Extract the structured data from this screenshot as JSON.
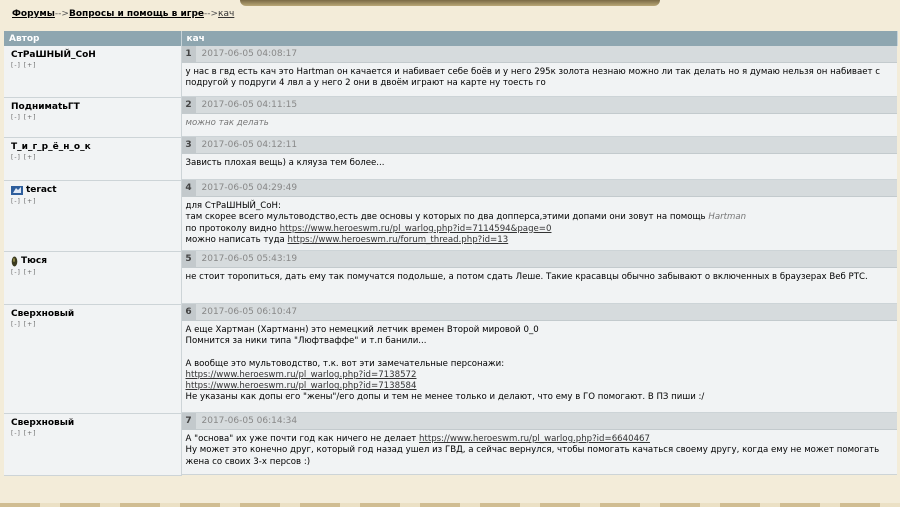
{
  "breadcrumb": {
    "forums": "Форумы",
    "sep1": "-->",
    "section": "Вопросы и помощь в игре",
    "sep2": "-->",
    "topic": "кач"
  },
  "table": {
    "col_author": "Автор",
    "col_topic": "кач"
  },
  "controls_text": "[-] [+]",
  "colors": {
    "header_bg": "#8ea6b0",
    "post_header_bg": "#d6dbdd",
    "post_bg": "#f1f3f4"
  },
  "posts": [
    {
      "author": "СтРаШНЫЙ_СоН",
      "num": "1",
      "date": "2017-06-05 04:08:17",
      "text": "у нас в гвд есть кач это Hartman он качается и набивает себе боёв и у него 295к золота незнаю можно ли так делать но я думаю нельзя он набивает с подругой у подруги 4 лвл а у него 2 они в двоём играют на карте ну тоесть го"
    },
    {
      "author": "ПоднимаtьГТ",
      "num": "2",
      "date": "2017-06-05 04:11:15",
      "text": "можно так делать"
    },
    {
      "author": "Т_и_г_р_ё_н_о_к",
      "num": "3",
      "date": "2017-06-05 04:12:11",
      "text": "Зависть плохая вещь) а кляуза тем более..."
    },
    {
      "author": "teract",
      "icon": "cat-emblem-icon",
      "num": "4",
      "date": "2017-06-05 04:29:49",
      "line1": "для СтРаШНЫЙ_СоН:",
      "line2a": "там скорее всего мультоводство,есть две основы у которых по два допперса,этими допами они зовут на помощь ",
      "line2b": "Hartman",
      "line3a": "по протоколу видно ",
      "link1": "https://www.heroeswm.ru/pl_warlog.php?id=7114594&page=0",
      "line4a": "можно написать туда ",
      "link2": "https://www.heroeswm.ru/forum_thread.php?id=13"
    },
    {
      "author": "Тюся",
      "icon": "bean-emblem-icon",
      "num": "5",
      "date": "2017-06-05 05:43:19",
      "text": "не стоит торопиться, дать ему так помучатся подольше, а потом сдать Леше. Такие красавцы обычно забывают о включенных в браузерах Веб РТС."
    },
    {
      "author": "Сверхновый",
      "num": "6",
      "date": "2017-06-05 06:10:47",
      "line1": "А еще Хартман (Хартманн) это немецкий летчик времен Второй мировой 0_0",
      "line2": "Помнится за ники типа \"Люфтваффе\" и т.п банили...",
      "line3": "А вообще это мультоводство, т.к. вот эти замечательные персонажи:",
      "link1": "https://www.heroeswm.ru/pl_warlog.php?id=7138572",
      "link2": "https://www.heroeswm.ru/pl_warlog.php?id=7138584",
      "line4": "Не указаны как допы его \"жены\"/его допы и тем не менее только и делают, что ему в ГО помогают. В ПЗ пиши :/"
    },
    {
      "author": "Сверхновый",
      "num": "7",
      "date": "2017-06-05 06:14:34",
      "line1a": "А \"основа\" их уже почти год как ничего не делает ",
      "link1": "https://www.heroeswm.ru/pl_warlog.php?id=6640467",
      "line2": "Ну может это конечно друг, который год назад ушел из ГВД, а сейчас вернулся, чтобы помогать качаться своему другу, когда ему не может помогать жена со своих 3-х персов :)"
    }
  ]
}
